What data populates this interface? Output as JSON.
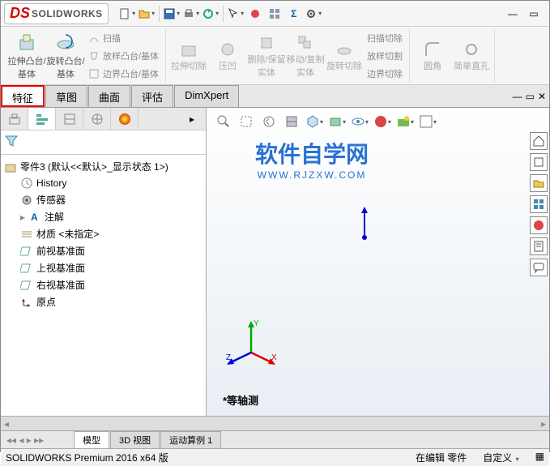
{
  "app": {
    "brand_prefix": "DS",
    "brand": "SOLIDWORKS"
  },
  "ribbon": {
    "extrude_boss": "拉伸凸台/基体",
    "revolve_boss": "旋转凸台/基体",
    "sweep": "扫描",
    "loft_boss": "放样凸台/基体",
    "boundary_boss": "边界凸台/基体",
    "extrude_cut": "拉伸切除",
    "hole": "压凹",
    "delete_keep": "删除/保留实体",
    "move_copy": "移动/复制实体",
    "revolve_cut": "旋转切除",
    "sweep_cut": "扫描切除",
    "loft_cut": "放样切割",
    "boundary_cut": "边界切除",
    "fillet": "圆角",
    "simple_hole": "简单直孔"
  },
  "tabs": {
    "t1": "特征",
    "t2": "草图",
    "t3": "曲面",
    "t4": "评估",
    "t5": "DimXpert"
  },
  "tree": {
    "root": "零件3 (默认<<默认>_显示状态 1>)",
    "history": "History",
    "sensors": "传感器",
    "annotations": "注解",
    "material": "材质 <未指定>",
    "front": "前视基准面",
    "top": "上视基准面",
    "right": "右视基准面",
    "origin": "原点"
  },
  "watermark": {
    "main": "软件自学网",
    "sub": "WWW.RJZXW.COM"
  },
  "view_label": "*等轴测",
  "bottom_tabs": {
    "b1": "模型",
    "b2": "3D 视图",
    "b3": "运动算例 1"
  },
  "status": {
    "version": "SOLIDWORKS Premium 2016 x64 版",
    "editing": "在编辑 零件",
    "custom": "自定义"
  }
}
